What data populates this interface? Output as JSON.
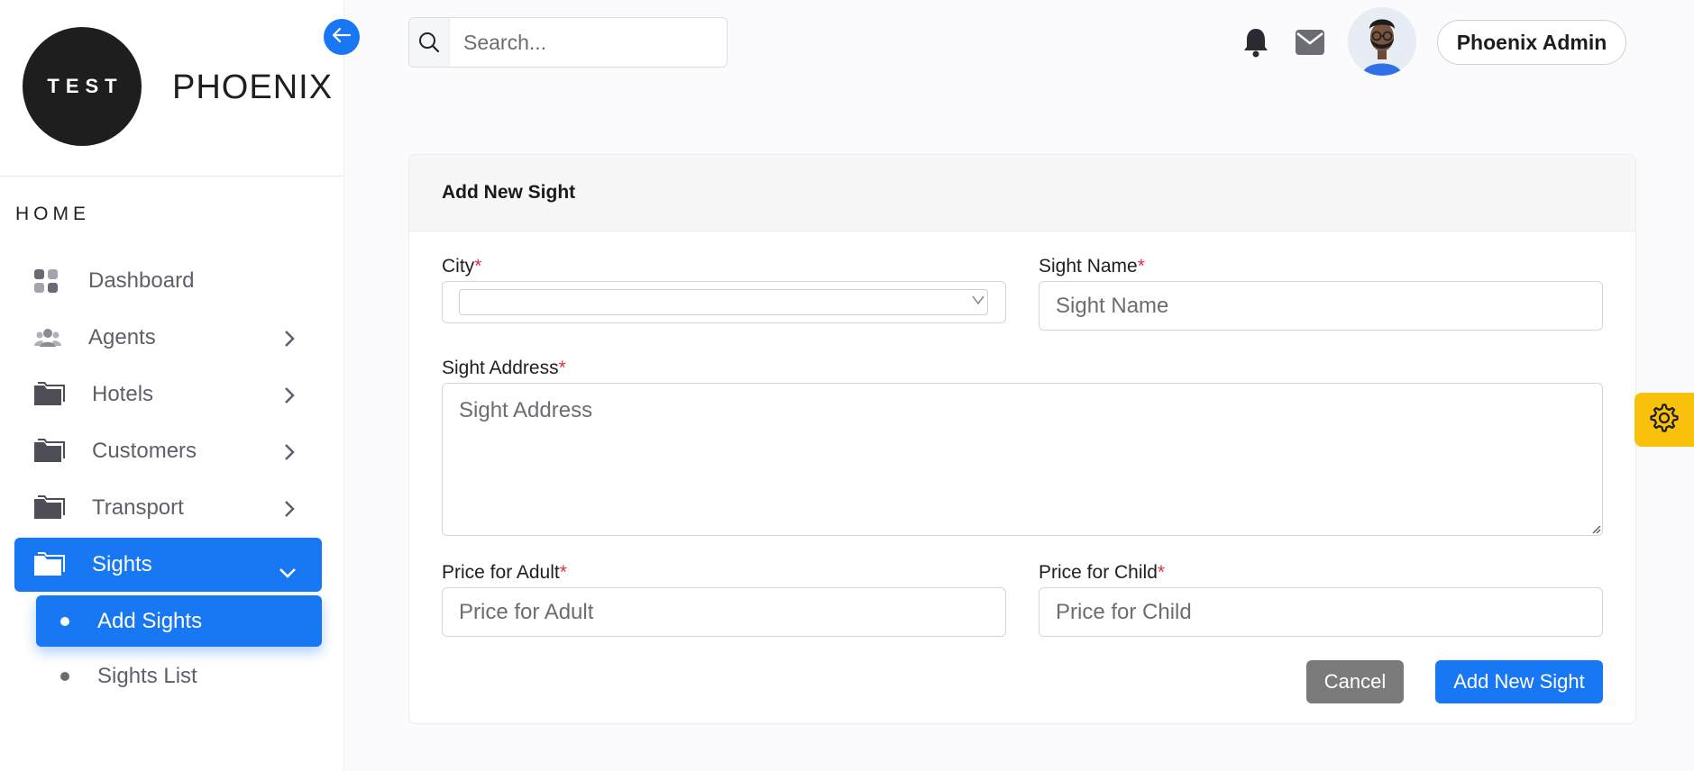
{
  "brand": {
    "logo_text": "TEST",
    "name": "PHOENIX"
  },
  "sidebar": {
    "section_title": "HOME",
    "items": [
      {
        "label": "Dashboard",
        "icon": "dashboard-grid-icon",
        "has_chevron": false
      },
      {
        "label": "Agents",
        "icon": "users-group-icon",
        "has_chevron": true
      },
      {
        "label": "Hotels",
        "icon": "folder-icon",
        "has_chevron": true
      },
      {
        "label": "Customers",
        "icon": "folder-icon",
        "has_chevron": true
      },
      {
        "label": "Transport",
        "icon": "folder-icon",
        "has_chevron": true
      },
      {
        "label": "Sights",
        "icon": "folder-icon",
        "has_chevron": true,
        "active": true,
        "expanded": true
      }
    ],
    "subitems": [
      {
        "label": "Add Sights",
        "active": true
      },
      {
        "label": "Sights List",
        "active": false
      }
    ]
  },
  "topbar": {
    "search_placeholder": "Search...",
    "user_name": "Phoenix Admin",
    "icons": [
      "bell-icon",
      "mail-icon",
      "avatar"
    ]
  },
  "form": {
    "title": "Add New Sight",
    "city_label": "City",
    "city_value": "",
    "sight_name_label": "Sight Name",
    "sight_name_placeholder": "Sight Name",
    "sight_address_label": "Sight Address",
    "sight_address_placeholder": "Sight Address",
    "price_adult_label": "Price for Adult",
    "price_adult_placeholder": "Price for Adult",
    "price_child_label": "Price for Child",
    "price_child_placeholder": "Price for Child",
    "required_mark": "*",
    "cancel_label": "Cancel",
    "submit_label": "Add New Sight"
  },
  "colors": {
    "primary": "#1877f2",
    "required": "#d63343",
    "settings_tab": "#f9c10c",
    "cancel": "#7a7a7a"
  }
}
